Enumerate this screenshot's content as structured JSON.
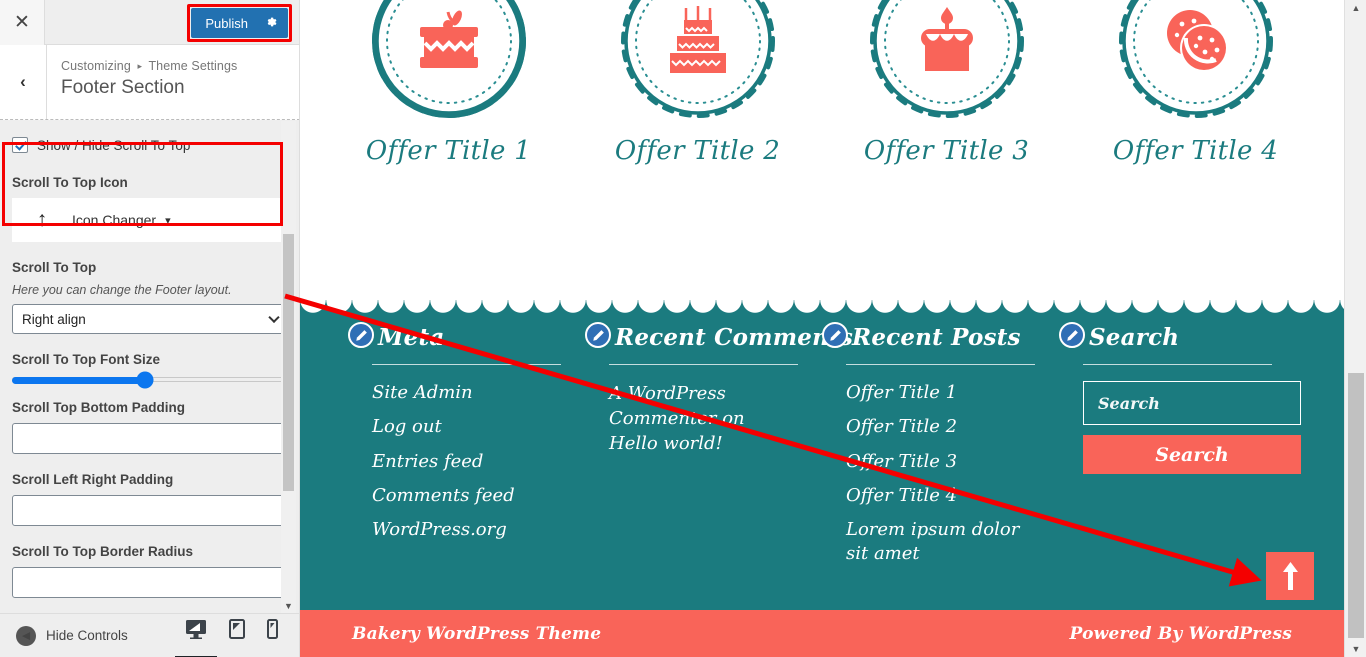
{
  "colors": {
    "accent_red": "#f40000",
    "teal": "#1b7b7f",
    "coral": "#f96459",
    "wp_blue": "#2271b1",
    "slider_blue": "#0b76ef"
  },
  "customizer": {
    "close_label": "✕",
    "publish_label": "Publish",
    "gear_icon": "gear-icon",
    "back_label": "‹",
    "breadcrumb_root": "Customizing",
    "breadcrumb_sep": "▸",
    "breadcrumb_parent": "Theme Settings",
    "section_title": "Footer Section",
    "controls": {
      "show_hide_label": "Show / Hide Scroll To Top",
      "show_hide_checked": true,
      "icon_label": "Scroll To Top Icon",
      "icon_changer_label": "Icon Changer",
      "icon_changer_glyph": "↑",
      "layout_label": "Scroll To Top",
      "layout_desc": "Here you can change the Footer layout.",
      "layout_value": "Right align",
      "font_size_label": "Scroll To Top Font Size",
      "font_size_percent": 48,
      "bottom_padding_label": "Scroll Top Bottom Padding",
      "bottom_padding_value": "",
      "lr_padding_label": "Scroll Left Right Padding",
      "lr_padding_value": "",
      "border_radius_label": "Scroll To Top Border Radius",
      "border_radius_value": ""
    },
    "bottom": {
      "hide_controls_label": "Hide Controls",
      "devices": [
        "desktop-icon",
        "tablet-icon",
        "mobile-icon"
      ],
      "active_device": "desktop-icon"
    }
  },
  "preview": {
    "offers": [
      {
        "title": "Offer Title 1",
        "icon": "cake-slice-icon"
      },
      {
        "title": "Offer Title 2",
        "icon": "tiered-cake-icon"
      },
      {
        "title": "Offer Title 3",
        "icon": "candle-cake-icon"
      },
      {
        "title": "Offer Title 4",
        "icon": "cookies-icon"
      }
    ],
    "widgets": [
      {
        "title": "Meta",
        "edit_icon": "pencil-edit-icon",
        "type": "links",
        "items": [
          "Site Admin",
          "Log out",
          "Entries feed",
          "Comments feed",
          "WordPress.org"
        ]
      },
      {
        "title": "Recent Comments",
        "edit_icon": "pencil-edit-icon",
        "type": "text",
        "text": "A WordPress Commenter on Hello world!"
      },
      {
        "title": "Recent Posts",
        "edit_icon": "pencil-edit-icon",
        "type": "links",
        "items": [
          "Offer Title 1",
          "Offer Title 2",
          "Offer Title 3",
          "Offer Title 4",
          "Lorem ipsum dolor sit amet"
        ]
      },
      {
        "title": "Search",
        "edit_icon": "pencil-edit-icon",
        "type": "search",
        "placeholder": "Search",
        "button_label": "Search"
      }
    ],
    "scroll_top_icon": "arrow-up-icon",
    "footer_left": "Bakery WordPress Theme",
    "footer_right": "Powered By WordPress"
  }
}
